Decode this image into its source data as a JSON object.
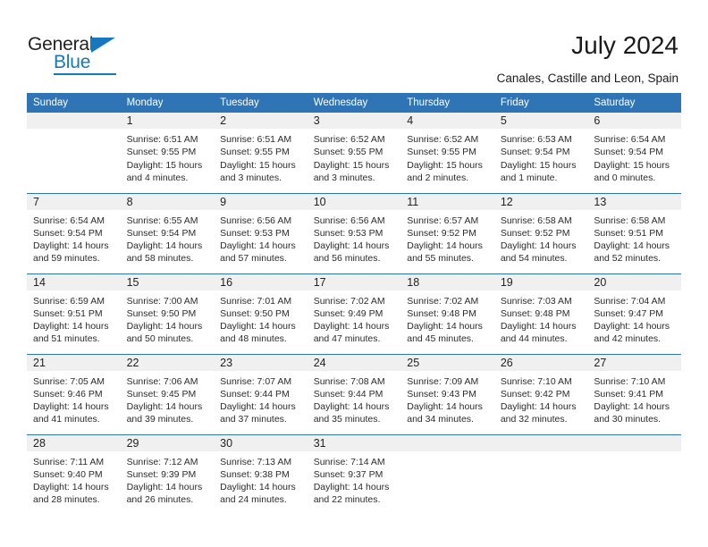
{
  "brand": {
    "name_part1": "General",
    "name_part2": "Blue",
    "logo_icon": "triangle-icon",
    "accent_color": "#1878be"
  },
  "header": {
    "title": "July 2024",
    "subtitle": "Canales, Castille and Leon, Spain"
  },
  "theme": {
    "header_blue": "#2f74b5",
    "daynum_band_gray": "#f0f0f0",
    "text_color": "#2b2b2b"
  },
  "calendar": {
    "weekday_headers": [
      "Sunday",
      "Monday",
      "Tuesday",
      "Wednesday",
      "Thursday",
      "Friday",
      "Saturday"
    ],
    "labels": {
      "sunrise": "Sunrise:",
      "sunset": "Sunset:",
      "daylight": "Daylight:"
    },
    "weeks": [
      [
        {
          "day": "",
          "empty": true
        },
        {
          "day": "1",
          "sunrise": "Sunrise: 6:51 AM",
          "sunset": "Sunset: 9:55 PM",
          "daylight_line1": "Daylight: 15 hours",
          "daylight_line2": "and 4 minutes."
        },
        {
          "day": "2",
          "sunrise": "Sunrise: 6:51 AM",
          "sunset": "Sunset: 9:55 PM",
          "daylight_line1": "Daylight: 15 hours",
          "daylight_line2": "and 3 minutes."
        },
        {
          "day": "3",
          "sunrise": "Sunrise: 6:52 AM",
          "sunset": "Sunset: 9:55 PM",
          "daylight_line1": "Daylight: 15 hours",
          "daylight_line2": "and 3 minutes."
        },
        {
          "day": "4",
          "sunrise": "Sunrise: 6:52 AM",
          "sunset": "Sunset: 9:55 PM",
          "daylight_line1": "Daylight: 15 hours",
          "daylight_line2": "and 2 minutes."
        },
        {
          "day": "5",
          "sunrise": "Sunrise: 6:53 AM",
          "sunset": "Sunset: 9:54 PM",
          "daylight_line1": "Daylight: 15 hours",
          "daylight_line2": "and 1 minute."
        },
        {
          "day": "6",
          "sunrise": "Sunrise: 6:54 AM",
          "sunset": "Sunset: 9:54 PM",
          "daylight_line1": "Daylight: 15 hours",
          "daylight_line2": "and 0 minutes."
        }
      ],
      [
        {
          "day": "7",
          "sunrise": "Sunrise: 6:54 AM",
          "sunset": "Sunset: 9:54 PM",
          "daylight_line1": "Daylight: 14 hours",
          "daylight_line2": "and 59 minutes."
        },
        {
          "day": "8",
          "sunrise": "Sunrise: 6:55 AM",
          "sunset": "Sunset: 9:54 PM",
          "daylight_line1": "Daylight: 14 hours",
          "daylight_line2": "and 58 minutes."
        },
        {
          "day": "9",
          "sunrise": "Sunrise: 6:56 AM",
          "sunset": "Sunset: 9:53 PM",
          "daylight_line1": "Daylight: 14 hours",
          "daylight_line2": "and 57 minutes."
        },
        {
          "day": "10",
          "sunrise": "Sunrise: 6:56 AM",
          "sunset": "Sunset: 9:53 PM",
          "daylight_line1": "Daylight: 14 hours",
          "daylight_line2": "and 56 minutes."
        },
        {
          "day": "11",
          "sunrise": "Sunrise: 6:57 AM",
          "sunset": "Sunset: 9:52 PM",
          "daylight_line1": "Daylight: 14 hours",
          "daylight_line2": "and 55 minutes."
        },
        {
          "day": "12",
          "sunrise": "Sunrise: 6:58 AM",
          "sunset": "Sunset: 9:52 PM",
          "daylight_line1": "Daylight: 14 hours",
          "daylight_line2": "and 54 minutes."
        },
        {
          "day": "13",
          "sunrise": "Sunrise: 6:58 AM",
          "sunset": "Sunset: 9:51 PM",
          "daylight_line1": "Daylight: 14 hours",
          "daylight_line2": "and 52 minutes."
        }
      ],
      [
        {
          "day": "14",
          "sunrise": "Sunrise: 6:59 AM",
          "sunset": "Sunset: 9:51 PM",
          "daylight_line1": "Daylight: 14 hours",
          "daylight_line2": "and 51 minutes."
        },
        {
          "day": "15",
          "sunrise": "Sunrise: 7:00 AM",
          "sunset": "Sunset: 9:50 PM",
          "daylight_line1": "Daylight: 14 hours",
          "daylight_line2": "and 50 minutes."
        },
        {
          "day": "16",
          "sunrise": "Sunrise: 7:01 AM",
          "sunset": "Sunset: 9:50 PM",
          "daylight_line1": "Daylight: 14 hours",
          "daylight_line2": "and 48 minutes."
        },
        {
          "day": "17",
          "sunrise": "Sunrise: 7:02 AM",
          "sunset": "Sunset: 9:49 PM",
          "daylight_line1": "Daylight: 14 hours",
          "daylight_line2": "and 47 minutes."
        },
        {
          "day": "18",
          "sunrise": "Sunrise: 7:02 AM",
          "sunset": "Sunset: 9:48 PM",
          "daylight_line1": "Daylight: 14 hours",
          "daylight_line2": "and 45 minutes."
        },
        {
          "day": "19",
          "sunrise": "Sunrise: 7:03 AM",
          "sunset": "Sunset: 9:48 PM",
          "daylight_line1": "Daylight: 14 hours",
          "daylight_line2": "and 44 minutes."
        },
        {
          "day": "20",
          "sunrise": "Sunrise: 7:04 AM",
          "sunset": "Sunset: 9:47 PM",
          "daylight_line1": "Daylight: 14 hours",
          "daylight_line2": "and 42 minutes."
        }
      ],
      [
        {
          "day": "21",
          "sunrise": "Sunrise: 7:05 AM",
          "sunset": "Sunset: 9:46 PM",
          "daylight_line1": "Daylight: 14 hours",
          "daylight_line2": "and 41 minutes."
        },
        {
          "day": "22",
          "sunrise": "Sunrise: 7:06 AM",
          "sunset": "Sunset: 9:45 PM",
          "daylight_line1": "Daylight: 14 hours",
          "daylight_line2": "and 39 minutes."
        },
        {
          "day": "23",
          "sunrise": "Sunrise: 7:07 AM",
          "sunset": "Sunset: 9:44 PM",
          "daylight_line1": "Daylight: 14 hours",
          "daylight_line2": "and 37 minutes."
        },
        {
          "day": "24",
          "sunrise": "Sunrise: 7:08 AM",
          "sunset": "Sunset: 9:44 PM",
          "daylight_line1": "Daylight: 14 hours",
          "daylight_line2": "and 35 minutes."
        },
        {
          "day": "25",
          "sunrise": "Sunrise: 7:09 AM",
          "sunset": "Sunset: 9:43 PM",
          "daylight_line1": "Daylight: 14 hours",
          "daylight_line2": "and 34 minutes."
        },
        {
          "day": "26",
          "sunrise": "Sunrise: 7:10 AM",
          "sunset": "Sunset: 9:42 PM",
          "daylight_line1": "Daylight: 14 hours",
          "daylight_line2": "and 32 minutes."
        },
        {
          "day": "27",
          "sunrise": "Sunrise: 7:10 AM",
          "sunset": "Sunset: 9:41 PM",
          "daylight_line1": "Daylight: 14 hours",
          "daylight_line2": "and 30 minutes."
        }
      ],
      [
        {
          "day": "28",
          "sunrise": "Sunrise: 7:11 AM",
          "sunset": "Sunset: 9:40 PM",
          "daylight_line1": "Daylight: 14 hours",
          "daylight_line2": "and 28 minutes."
        },
        {
          "day": "29",
          "sunrise": "Sunrise: 7:12 AM",
          "sunset": "Sunset: 9:39 PM",
          "daylight_line1": "Daylight: 14 hours",
          "daylight_line2": "and 26 minutes."
        },
        {
          "day": "30",
          "sunrise": "Sunrise: 7:13 AM",
          "sunset": "Sunset: 9:38 PM",
          "daylight_line1": "Daylight: 14 hours",
          "daylight_line2": "and 24 minutes."
        },
        {
          "day": "31",
          "sunrise": "Sunrise: 7:14 AM",
          "sunset": "Sunset: 9:37 PM",
          "daylight_line1": "Daylight: 14 hours",
          "daylight_line2": "and 22 minutes."
        },
        {
          "day": "",
          "empty": true
        },
        {
          "day": "",
          "empty": true
        },
        {
          "day": "",
          "empty": true
        }
      ]
    ]
  }
}
